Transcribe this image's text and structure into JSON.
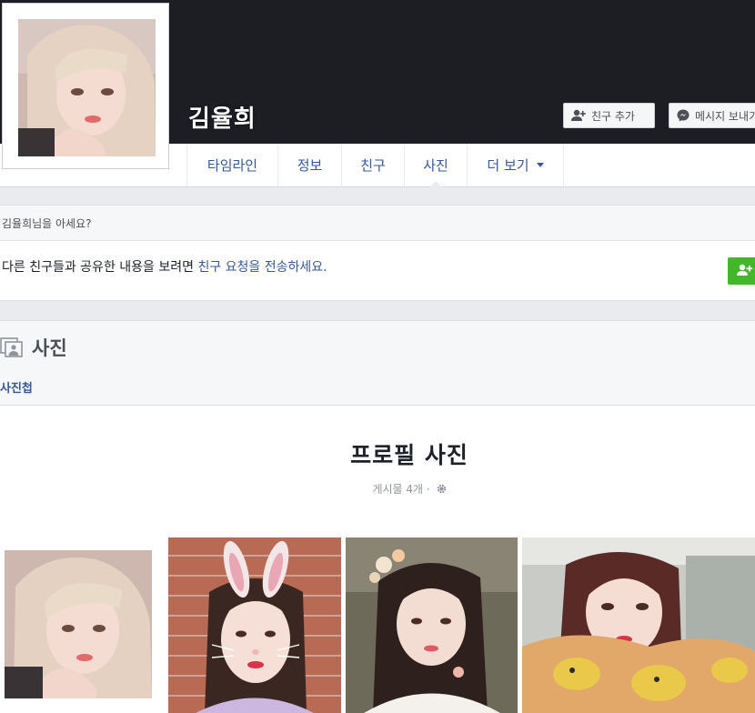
{
  "profile": {
    "name": "김율희",
    "add_friend_label": "친구 추가",
    "message_label": "메시지 보내기"
  },
  "tabs": [
    {
      "label": "타임라인"
    },
    {
      "label": "정보"
    },
    {
      "label": "친구"
    },
    {
      "label": "사진",
      "active": true
    },
    {
      "label": "더 보기"
    }
  ],
  "know_box": {
    "header": "김율희님을 아세요?",
    "text_before": "다른 친구들과 공유한 내용을 보려면 ",
    "link": "친구 요청을 전송하세요."
  },
  "photos": {
    "title": "사진",
    "albums_link": "사진첩",
    "album_title": "프로필 사진",
    "album_meta": "게시물 4개 ·"
  },
  "icons": {
    "add_friend": "person-plus-icon",
    "messenger": "messenger-icon",
    "photos": "photos-icon",
    "privacy": "gear-icon"
  },
  "colors": {
    "cover": "#1c1e24",
    "link": "#365899",
    "green": "#42b72a"
  }
}
